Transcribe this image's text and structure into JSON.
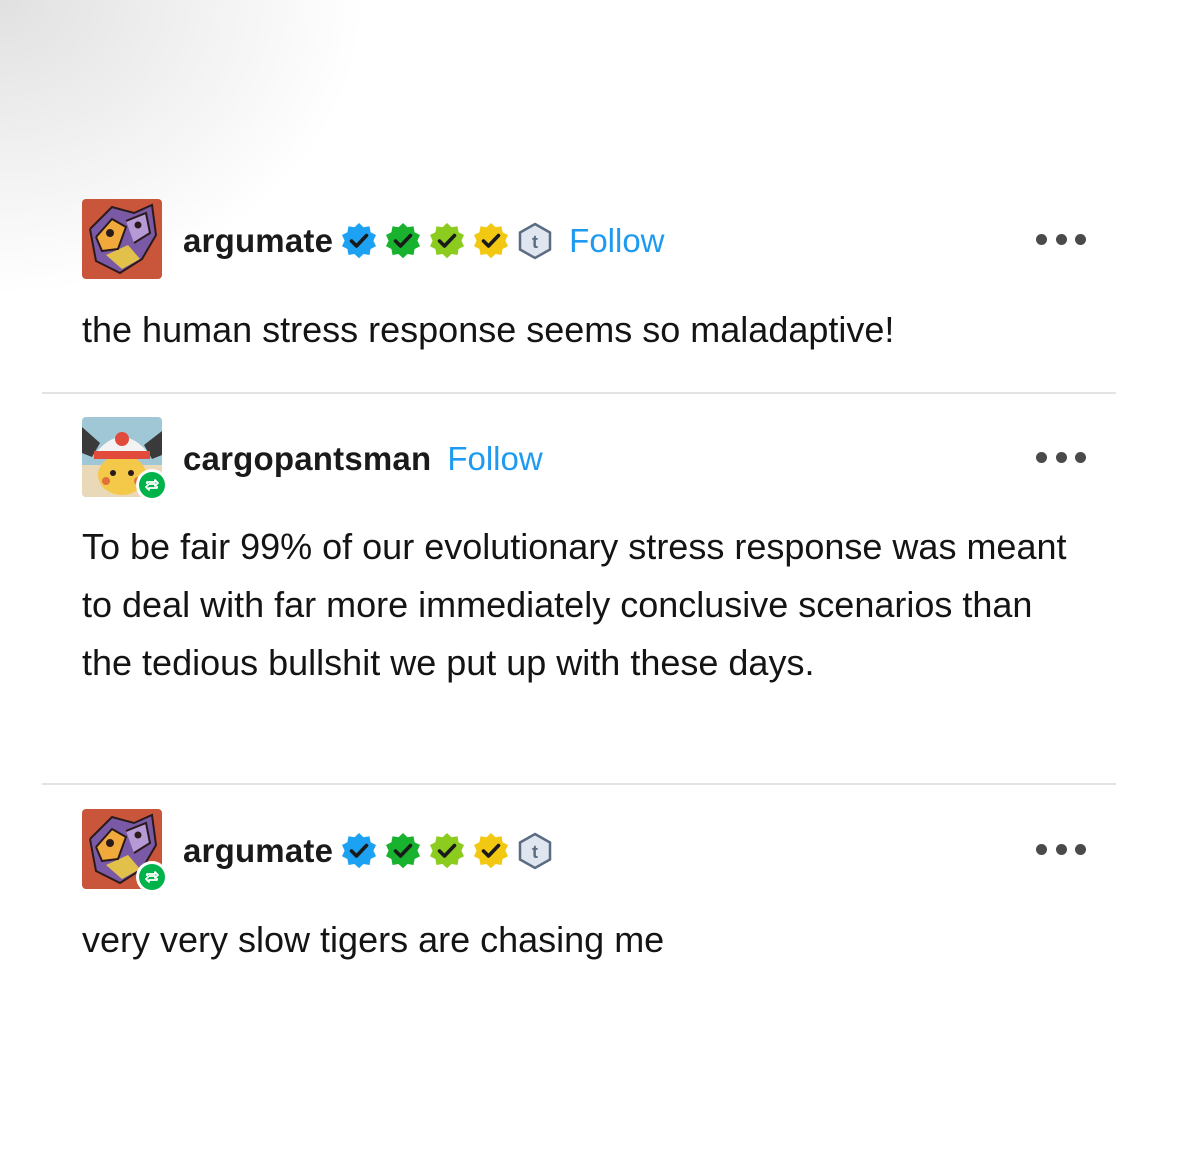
{
  "posts": [
    {
      "username": "argumate",
      "follow_label": "Follow",
      "reblogged": false,
      "badges": [
        "blue-verified-badge",
        "green-verified-badge",
        "lime-verified-badge",
        "yellow-verified-badge",
        "tumblr-t-badge"
      ],
      "text": "the human stress response seems so maladaptive!"
    },
    {
      "username": "cargopantsman",
      "follow_label": "Follow",
      "reblogged": true,
      "badges": [],
      "text": "To be fair 99% of our evolutionary stress response was meant to deal with far more immediately conclusive scenarios than the tedious bullshit we put up with these days."
    },
    {
      "username": "argumate",
      "follow_label": "",
      "reblogged": true,
      "badges": [
        "blue-verified-badge",
        "green-verified-badge",
        "lime-verified-badge",
        "yellow-verified-badge",
        "tumblr-t-badge"
      ],
      "text": "very very slow tigers are chasing me"
    }
  ],
  "colors": {
    "follow": "#1e9bf0",
    "badge_blue": "#1da1f2",
    "badge_green": "#19b22e",
    "badge_lime": "#8ccc1f",
    "badge_yellow": "#f2c813",
    "badge_tumblr": "#5b6b82",
    "reblog_green": "#00b24a",
    "divider": "#e3e3e3"
  },
  "icons": {
    "more": "more-options-icon",
    "reblog": "reblog-icon"
  }
}
